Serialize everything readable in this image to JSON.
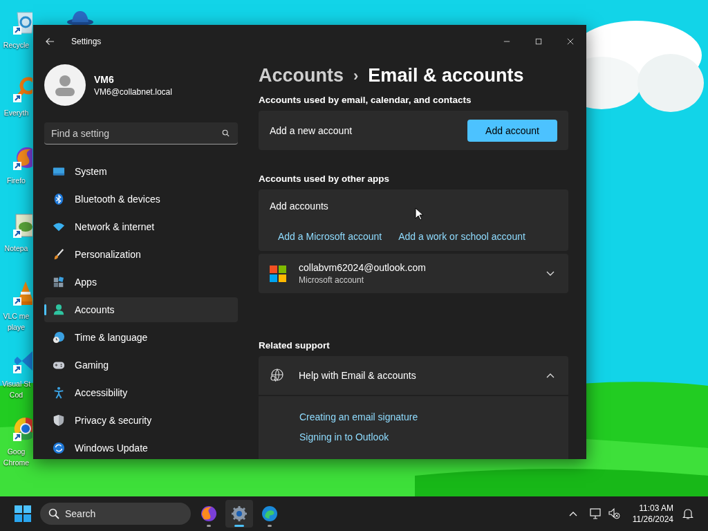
{
  "desktop": {
    "icons": [
      {
        "lines": [
          "Recycle"
        ]
      },
      {
        "lines": [
          "Everyth"
        ]
      },
      {
        "lines": [
          "Firefo"
        ]
      },
      {
        "lines": [
          "Notepa"
        ]
      },
      {
        "lines": [
          "VLC me",
          "playe"
        ]
      },
      {
        "lines": [
          "Visual St",
          "Cod"
        ]
      },
      {
        "lines": [
          "Goog",
          "Chrome"
        ]
      }
    ]
  },
  "window": {
    "title": "Settings",
    "user": {
      "name": "VM6",
      "email": "VM6@collabnet.local"
    },
    "search": {
      "placeholder": "Find a setting"
    },
    "nav": [
      {
        "label": "System",
        "selected": false
      },
      {
        "label": "Bluetooth & devices",
        "selected": false
      },
      {
        "label": "Network & internet",
        "selected": false
      },
      {
        "label": "Personalization",
        "selected": false
      },
      {
        "label": "Apps",
        "selected": false
      },
      {
        "label": "Accounts",
        "selected": true
      },
      {
        "label": "Time & language",
        "selected": false
      },
      {
        "label": "Gaming",
        "selected": false
      },
      {
        "label": "Accessibility",
        "selected": false
      },
      {
        "label": "Privacy & security",
        "selected": false
      },
      {
        "label": "Windows Update",
        "selected": false
      }
    ],
    "breadcrumb": {
      "parent": "Accounts",
      "separator": "›",
      "current": "Email & accounts"
    },
    "sections": [
      {
        "kind": "add",
        "heading": "Accounts used by email, calendar, and contacts",
        "label": "Add a new account",
        "button": "Add account"
      },
      {
        "kind": "links",
        "heading": "Accounts used by other apps",
        "label": "Add accounts",
        "links": [
          "Add a Microsoft account",
          "Add a work or school account"
        ]
      },
      {
        "kind": "account",
        "email": "collabvm62024@outlook.com",
        "type": "Microsoft account",
        "expanded": false
      },
      {
        "kind": "help",
        "heading": "Related support",
        "label": "Help with Email & accounts",
        "expanded": true,
        "links": [
          "Creating an email signature",
          "Signing in to Outlook"
        ]
      }
    ]
  },
  "taskbar": {
    "search": {
      "placeholder": "Search"
    },
    "apps": [
      {
        "selected": false,
        "running": true
      },
      {
        "selected": true,
        "running": true
      },
      {
        "selected": false,
        "running": true
      }
    ],
    "time": "11:03 AM",
    "date": "11/26/2024"
  }
}
